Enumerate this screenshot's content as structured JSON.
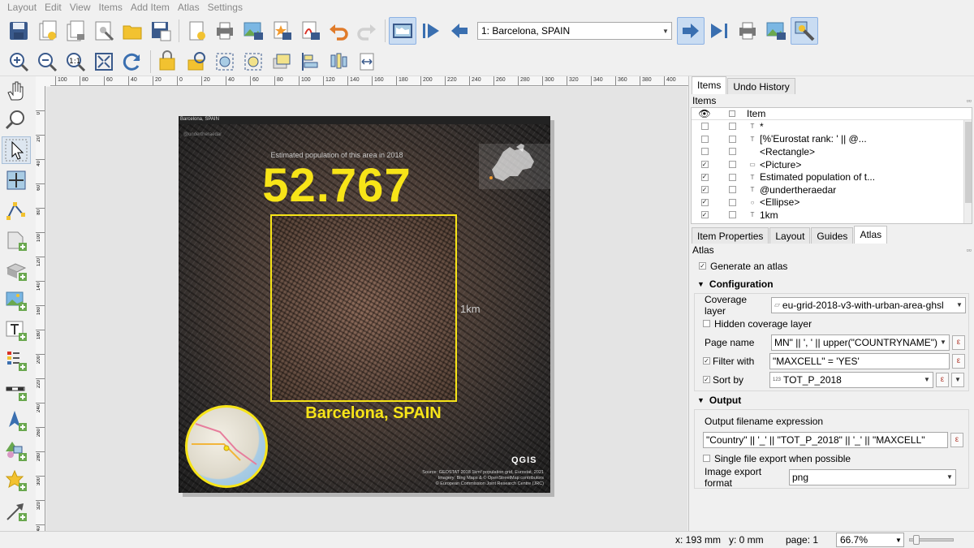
{
  "menu": [
    "Layout",
    "Edit",
    "View",
    "Items",
    "Add Item",
    "Atlas",
    "Settings"
  ],
  "atlas_toolbar": {
    "current_feature": "1: Barcelona, SPAIN"
  },
  "ruler": {
    "top_ticks": [
      "100",
      "80",
      "60",
      "40",
      "20",
      "0",
      "20",
      "40",
      "60",
      "80",
      "100",
      "120",
      "140",
      "160",
      "180",
      "200",
      "220",
      "240",
      "260",
      "280",
      "300",
      "320",
      "340",
      "360",
      "380",
      "400"
    ],
    "left_ticks": [
      "0",
      "20",
      "40",
      "60",
      "80",
      "100",
      "120",
      "140",
      "160",
      "180",
      "200",
      "220",
      "240",
      "260",
      "280",
      "300",
      "320",
      "340"
    ]
  },
  "page": {
    "tab_label": "Barcelona, SPAIN",
    "estimated_label": "Estimated population of this area in 2018",
    "population": "52.767",
    "handle": "@undertheraedar",
    "km_label": "1km",
    "city": "Barcelona, SPAIN",
    "logo": "QGIS",
    "source_lines": [
      "Source: GEOSTAT 2018 1km² population grid, Eurostat, 2021",
      "Imagery: Bing Maps & © OpenStreetMap contributors",
      "© European Commission Joint Research Centre (JRC)"
    ],
    "accent": "#f7e418"
  },
  "panel_top": {
    "tabs": [
      "Items",
      "Undo History"
    ],
    "title": "Items",
    "header_item": "Item",
    "items": [
      {
        "visible": false,
        "type": "T",
        "label": "*"
      },
      {
        "visible": false,
        "type": "T",
        "label": "[%'Eurostat rank: ' || @..."
      },
      {
        "visible": false,
        "type": "",
        "label": "<Rectangle>"
      },
      {
        "visible": true,
        "type": "▭",
        "label": "<Picture>"
      },
      {
        "visible": true,
        "type": "T",
        "label": "Estimated population of t..."
      },
      {
        "visible": true,
        "type": "T",
        "label": "@undertheraedar"
      },
      {
        "visible": true,
        "type": "○",
        "label": "<Ellipse>"
      },
      {
        "visible": true,
        "type": "T",
        "label": "1km"
      },
      {
        "visible": true,
        "type": "T",
        "label": "Source: GEOSTAT 2018 1km²"
      }
    ]
  },
  "panel_bottom": {
    "tabs": [
      "Item Properties",
      "Layout",
      "Guides",
      "Atlas"
    ],
    "title": "Atlas",
    "generate": "Generate an atlas",
    "configuration": "Configuration",
    "coverage_label": "Coverage layer",
    "coverage_value": "eu-grid-2018-v3-with-urban-area-ghsl",
    "hidden_coverage": "Hidden coverage layer",
    "page_name_label": "Page name",
    "page_name_value": "MN\"  || ', ' || upper(\"COUNTRYNAME\")",
    "filter_label": "Filter with",
    "filter_value": "\"MAXCELL\"  =  'YES'",
    "sort_label": "Sort by",
    "sort_value": "TOT_P_2018",
    "output": "Output",
    "output_expr_label": "Output filename expression",
    "output_expr_value": "\"Country\"  ||  '_' || \"TOT_P_2018\"  || '_' ||  \"MAXCELL\"",
    "single_file": "Single file export when possible",
    "image_format_label": "Image export format",
    "image_format_value": "png"
  },
  "status": {
    "x": "x: 193 mm",
    "y": "y: 0 mm",
    "page": "page: 1",
    "zoom": "66.7%"
  }
}
